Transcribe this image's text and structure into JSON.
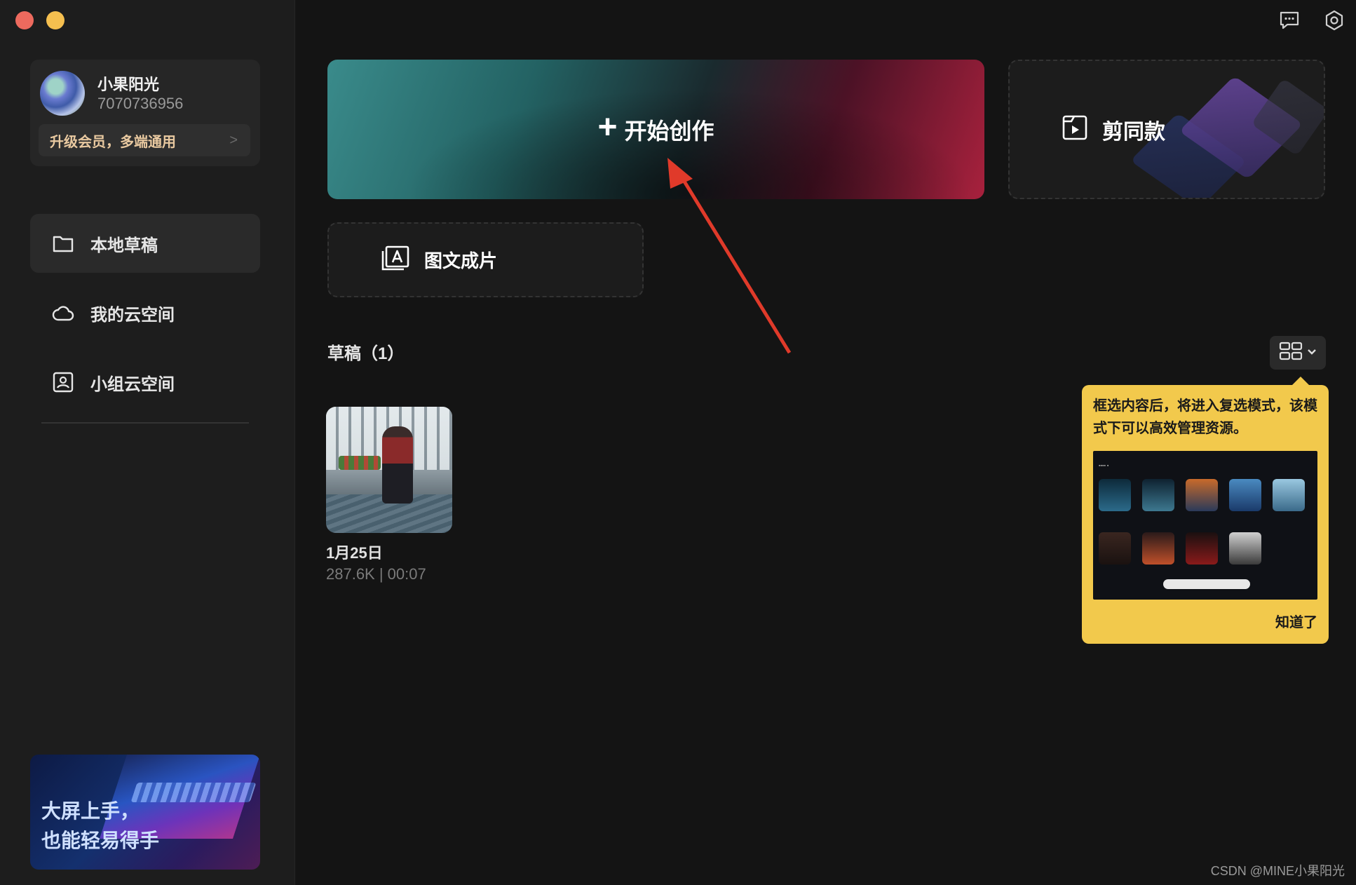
{
  "window": {
    "controls": [
      "close",
      "minimize"
    ]
  },
  "user": {
    "name": "小果阳光",
    "id": "7070736956",
    "upgrade_label": "升级会员，多端通用",
    "upgrade_chevron": ">"
  },
  "nav": {
    "items": [
      {
        "label": "本地草稿",
        "icon": "folder-icon",
        "active": true
      },
      {
        "label": "我的云空间",
        "icon": "cloud-icon",
        "active": false
      },
      {
        "label": "小组云空间",
        "icon": "team-space-icon",
        "active": false
      }
    ]
  },
  "promo": {
    "line1": "大屏上手，",
    "line2": "也能轻易得手"
  },
  "top_icons": [
    "feedback-icon",
    "settings-icon"
  ],
  "main": {
    "start_plus": "+",
    "start_label": "开始创作",
    "template_label": "剪同款",
    "pic_label": "图文成片"
  },
  "drafts": {
    "title": "草稿（1）",
    "items": [
      {
        "name": "1月25日",
        "meta": "287.6K | 00:07"
      }
    ]
  },
  "tooltip": {
    "text": "框选内容后，将进入复选模式，该模式下可以高效管理资源。",
    "button": "知道了"
  },
  "colors": {
    "background": "#141414",
    "sidebar": "#1d1d1d",
    "accent_yellow": "#f2c94c",
    "gradient_teal": "#3a8b8b",
    "gradient_red": "#a8213d"
  },
  "watermark": "CSDN @MINE小果阳光"
}
